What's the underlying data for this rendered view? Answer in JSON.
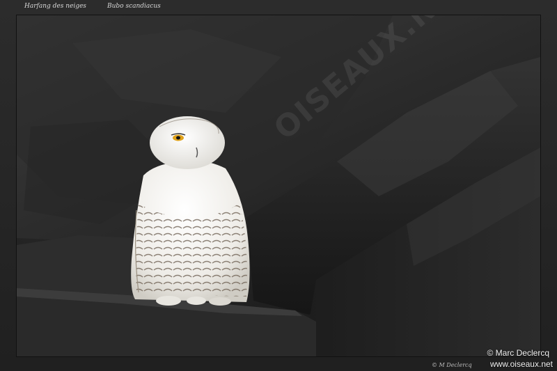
{
  "caption": {
    "common_name": "Harfang des neiges",
    "latin_name": "Bubo  scandiacus"
  },
  "photo": {
    "subject": "snowy-owl-on-dark-rocks",
    "watermark_text": "OISEAUX.NET"
  },
  "credits": {
    "author": "© Marc Declercq",
    "site": "www.oiseaux.net",
    "small_credit": "©  M Declercq"
  },
  "colors": {
    "frame": "#262626",
    "rock_dark": "#1c1c1c",
    "rock_mid": "#2e2e2e",
    "owl_white": "#f0efec",
    "owl_bars": "#5a4e42",
    "eye": "#e0a21a"
  }
}
